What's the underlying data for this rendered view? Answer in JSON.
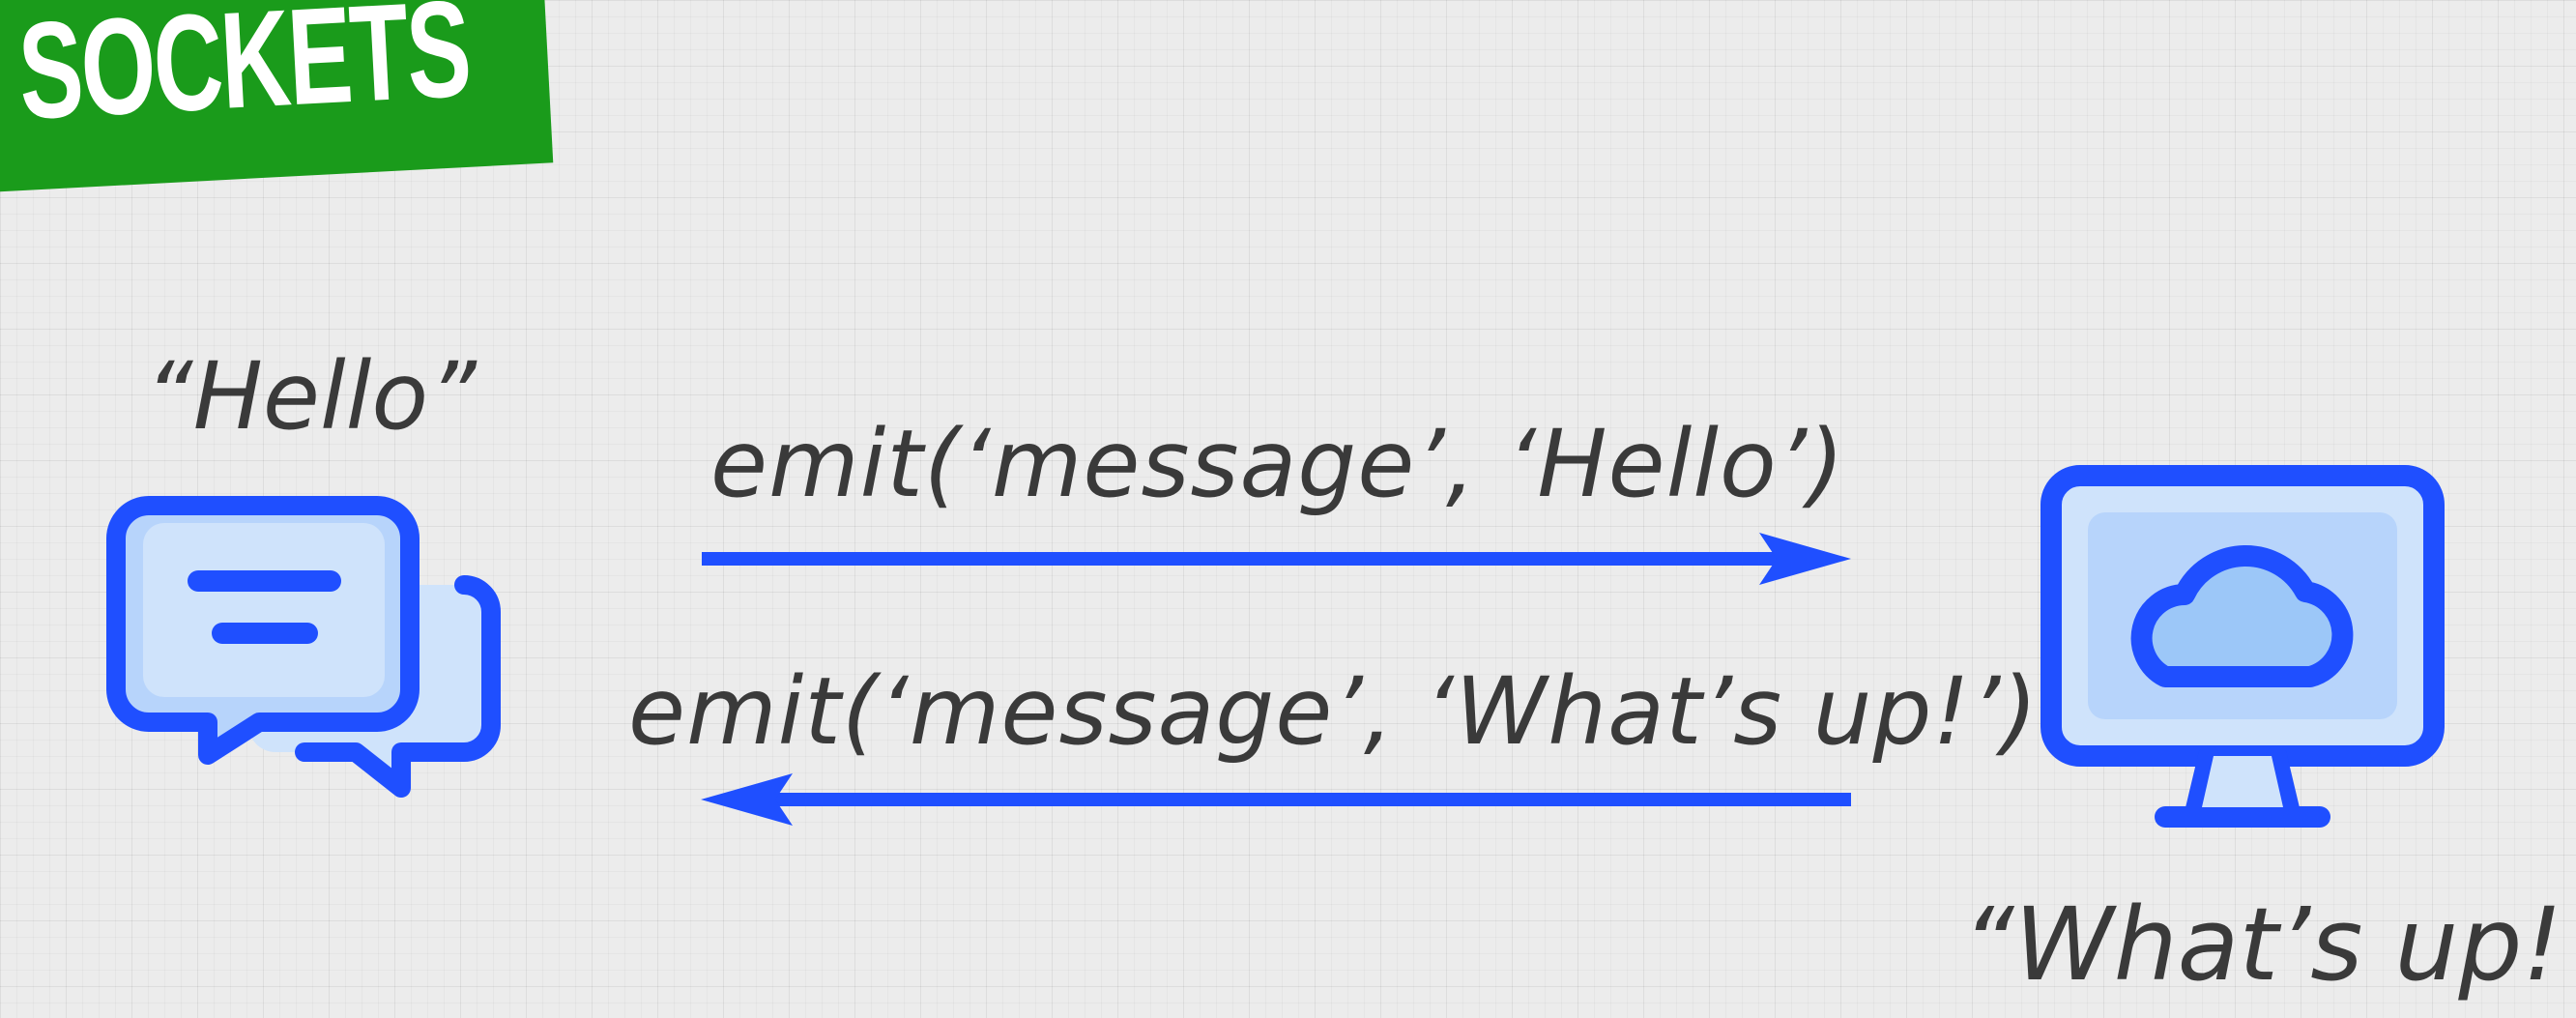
{
  "banner": {
    "title": "SOCKETS",
    "color": "#1a9b1b"
  },
  "client": {
    "quote": "“Hello”",
    "icon": "chat-bubbles-icon"
  },
  "server": {
    "quote": "“What’s up!”",
    "icon": "monitor-cloud-icon"
  },
  "messages": [
    {
      "text": "emit(‘message’, ‘Hello’)",
      "direction": "client-to-server"
    },
    {
      "text": "emit(‘message’, ‘What’s up!’)",
      "direction": "server-to-client"
    }
  ],
  "colors": {
    "accent": "#1f4fff",
    "icon_fill": "#cfe3fb",
    "icon_fill_inner": "#b7d4fb",
    "cloud_fill": "#9cc7f8",
    "text": "#3a3a3a"
  }
}
